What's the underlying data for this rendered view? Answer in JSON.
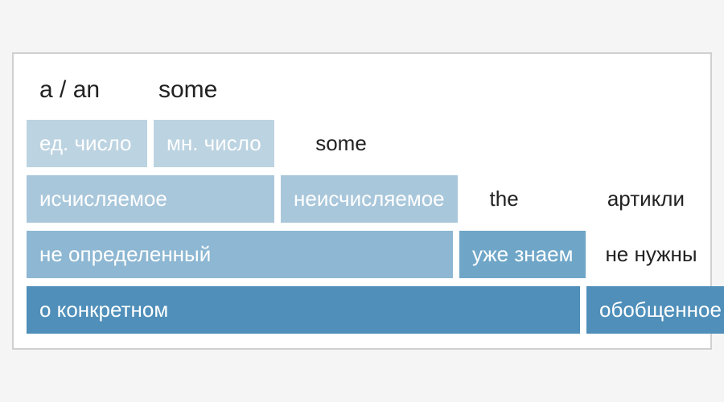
{
  "colors": {
    "c1": "#bcd3e1",
    "c2": "#a9c7db",
    "c3": "#8db7d2",
    "c4": "#6fa6c8",
    "c5": "#4f8fba"
  },
  "row0": {
    "a_an": "a / an",
    "some": "some"
  },
  "row1": {
    "singular": "ед. число",
    "plural": "мн. число",
    "some": "some"
  },
  "row2": {
    "countable": "исчисляемое",
    "uncountable": "неисчисляемое",
    "the": "the",
    "articles": "артикли"
  },
  "row3": {
    "indefinite": "не определенный",
    "already_known": "уже знаем",
    "not_needed": "не нужны"
  },
  "row4": {
    "about_specific": "о конкретном",
    "generalized": "обобщенное"
  }
}
